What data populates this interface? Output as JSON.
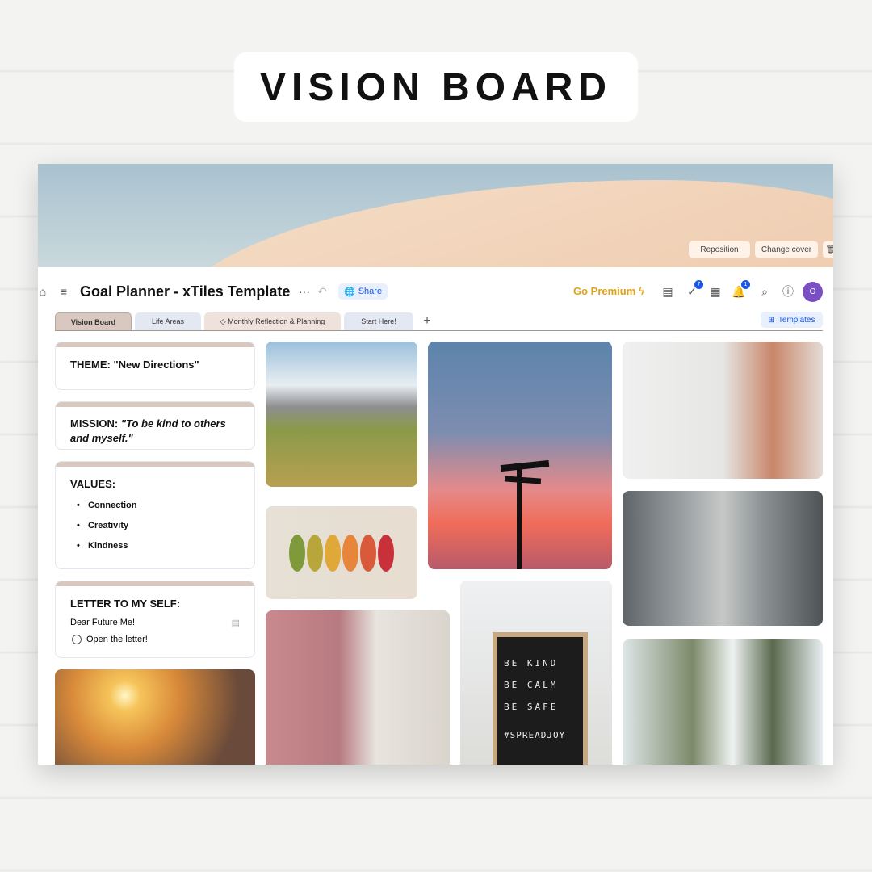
{
  "page_title": "VISION BOARD",
  "cover": {
    "reposition": "Reposition",
    "change_cover": "Change cover"
  },
  "header": {
    "title": "Goal Planner - xTiles Template",
    "share": "Share",
    "go_premium": "Go Premium",
    "tasks_badge": "7",
    "notifications_badge": "1",
    "avatar_initial": "O",
    "templates": "Templates"
  },
  "tabs": [
    {
      "label": "Vision Board",
      "active": true
    },
    {
      "label": "Life Areas"
    },
    {
      "label": "Monthly Reflection & Planning"
    },
    {
      "label": "Start Here!"
    }
  ],
  "cards": {
    "theme": "THEME: \"New Directions\"",
    "mission_label": "MISSION: ",
    "mission_text": "\"To be kind to others and myself.\"",
    "values_title": "VALUES:",
    "values": [
      "Connection",
      "Creativity",
      "Kindness"
    ],
    "letter_title": "LETTER TO MY SELF:",
    "letter_line": "Dear Future Me!",
    "letter_todo": "Open the letter!"
  },
  "letterboard": [
    "BE KIND",
    "BE CALM",
    "BE SAFE",
    "#SPREADJOY"
  ],
  "colors": {
    "accent": "#1a56e8",
    "premium": "#e0a21a",
    "tab_active": "#d8c8bf",
    "avatar": "#7b4fc4"
  }
}
